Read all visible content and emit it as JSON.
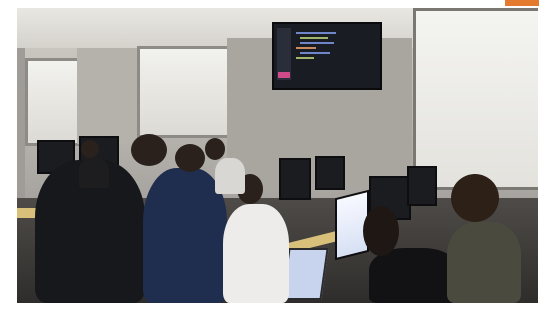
{
  "scene": {
    "description_tags": [
      "classroom",
      "computer-lab",
      "people",
      "monitors"
    ],
    "colors": {
      "wall": "#a9a6a0",
      "floor": "#3a3734",
      "desk": "#d9c07a",
      "tv_screen": "#1a1c24",
      "accent": "#e47a2e"
    },
    "icons": [
      "photo"
    ]
  }
}
